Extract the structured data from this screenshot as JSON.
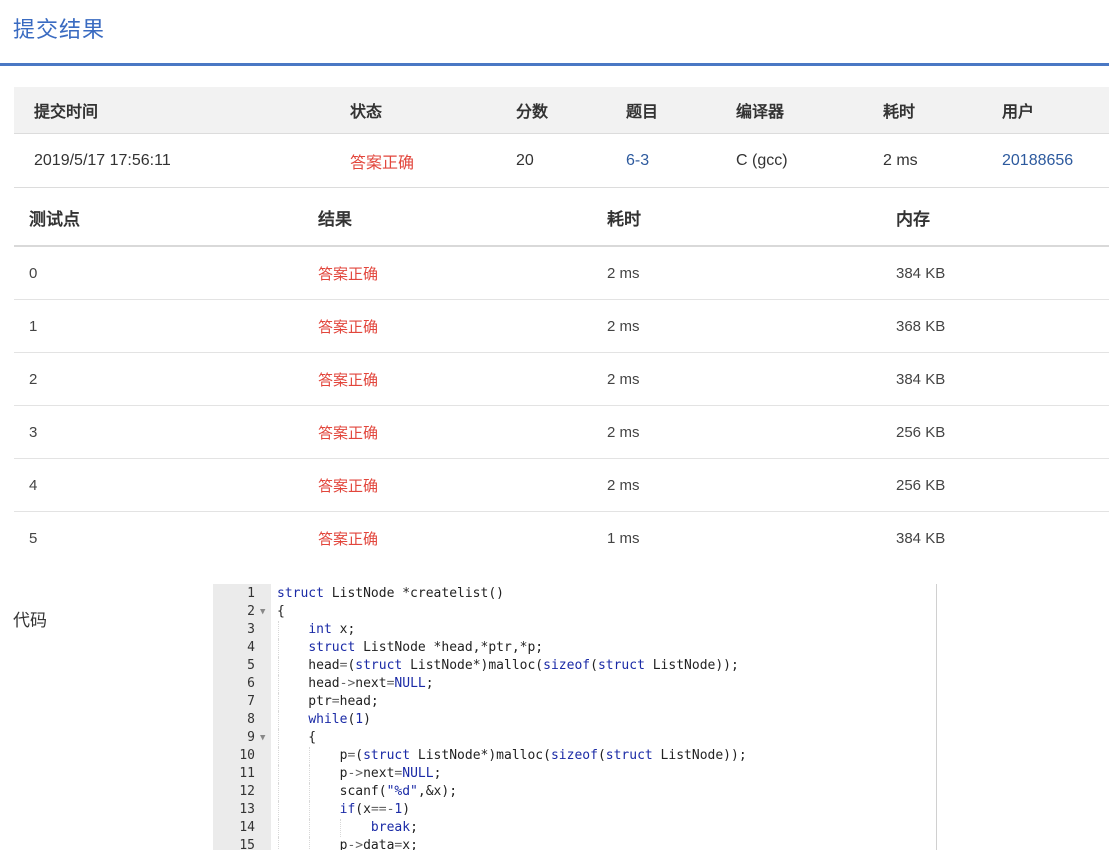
{
  "page": {
    "title": "提交结果"
  },
  "summary": {
    "headers": [
      "提交时间",
      "状态",
      "分数",
      "题目",
      "编译器",
      "耗时",
      "用户"
    ],
    "row": {
      "time": "2019/5/17 17:56:11",
      "status": "答案正确",
      "score": "20",
      "problem": "6-3",
      "compiler": "C (gcc)",
      "elapsed": "2 ms",
      "user": "20188656"
    }
  },
  "testcases": {
    "headers": [
      "测试点",
      "结果",
      "耗时",
      "内存"
    ],
    "rows": [
      {
        "id": "0",
        "result": "答案正确",
        "time": "2 ms",
        "memory": "384 KB"
      },
      {
        "id": "1",
        "result": "答案正确",
        "time": "2 ms",
        "memory": "368 KB"
      },
      {
        "id": "2",
        "result": "答案正确",
        "time": "2 ms",
        "memory": "384 KB"
      },
      {
        "id": "3",
        "result": "答案正确",
        "time": "2 ms",
        "memory": "256 KB"
      },
      {
        "id": "4",
        "result": "答案正确",
        "time": "2 ms",
        "memory": "256 KB"
      },
      {
        "id": "5",
        "result": "答案正确",
        "time": "1 ms",
        "memory": "384 KB"
      }
    ]
  },
  "code": {
    "label": "代码",
    "lines": [
      {
        "n": "1",
        "fold": false,
        "text": "struct ListNode *createlist()"
      },
      {
        "n": "2",
        "fold": true,
        "text": "{"
      },
      {
        "n": "3",
        "fold": false,
        "text": "    int x;"
      },
      {
        "n": "4",
        "fold": false,
        "text": "    struct ListNode *head,*ptr,*p;"
      },
      {
        "n": "5",
        "fold": false,
        "text": "    head=(struct ListNode*)malloc(sizeof(struct ListNode));"
      },
      {
        "n": "6",
        "fold": false,
        "text": "    head->next=NULL;"
      },
      {
        "n": "7",
        "fold": false,
        "text": "    ptr=head;"
      },
      {
        "n": "8",
        "fold": false,
        "text": "    while(1)"
      },
      {
        "n": "9",
        "fold": true,
        "text": "    {"
      },
      {
        "n": "10",
        "fold": false,
        "text": "        p=(struct ListNode*)malloc(sizeof(struct ListNode));"
      },
      {
        "n": "11",
        "fold": false,
        "text": "        p->next=NULL;"
      },
      {
        "n": "12",
        "fold": false,
        "text": "        scanf(\"%d\",&x);"
      },
      {
        "n": "13",
        "fold": false,
        "text": "        if(x==-1)"
      },
      {
        "n": "14",
        "fold": false,
        "text": "            break;"
      },
      {
        "n": "15",
        "fold": false,
        "text": "        p->data=x;"
      }
    ]
  },
  "colors": {
    "accent": "#3a6bc1",
    "success": "#e2463c",
    "link": "#2d5a9e"
  }
}
